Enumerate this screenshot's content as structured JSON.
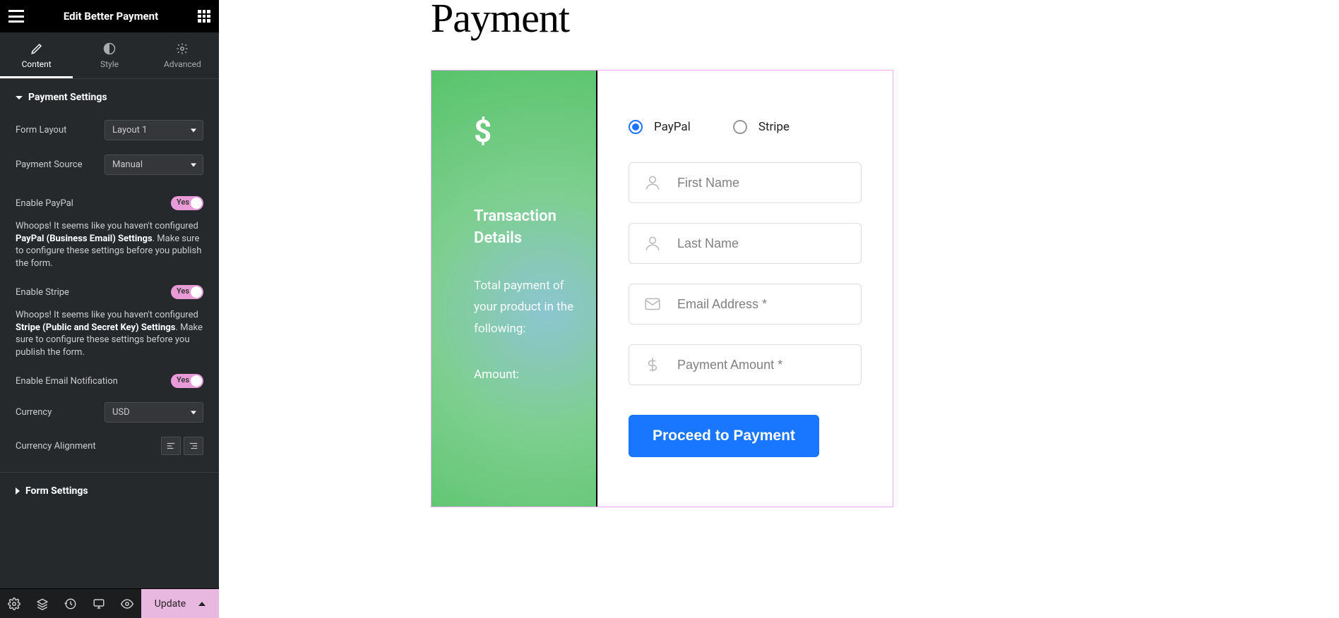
{
  "header": {
    "title": "Edit Better Payment"
  },
  "tabs": {
    "content": "Content",
    "style": "Style",
    "advanced": "Advanced"
  },
  "sections": {
    "payment_settings": "Payment Settings",
    "form_settings": "Form Settings"
  },
  "controls": {
    "form_layout": {
      "label": "Form Layout",
      "value": "Layout 1"
    },
    "payment_source": {
      "label": "Payment Source",
      "value": "Manual"
    },
    "enable_paypal": {
      "label": "Enable PayPal",
      "toggle_text": "Yes"
    },
    "paypal_warning_pre": "Whoops! It seems like you haven't configured ",
    "paypal_warning_bold": "PayPal (Business Email) Settings",
    "paypal_warning_post": ". Make sure to configure these settings before you publish the form.",
    "enable_stripe": {
      "label": "Enable Stripe",
      "toggle_text": "Yes"
    },
    "stripe_warning_pre": "Whoops! It seems like you haven't configured ",
    "stripe_warning_bold": "Stripe (Public and Secret Key) Settings",
    "stripe_warning_post": ". Make sure to configure these settings before you publish the form.",
    "enable_email": {
      "label": "Enable Email Notification",
      "toggle_text": "Yes"
    },
    "currency": {
      "label": "Currency",
      "value": "USD"
    },
    "currency_alignment": {
      "label": "Currency Alignment"
    }
  },
  "footer": {
    "update": "Update"
  },
  "page": {
    "title": "Payment"
  },
  "widget": {
    "left": {
      "heading": "Transaction Details",
      "desc": "Total payment of your product in the following:",
      "amount_label": "Amount:"
    },
    "right": {
      "paypal": "PayPal",
      "stripe": "Stripe",
      "first_name": "First Name",
      "last_name": "Last Name",
      "email": "Email Address *",
      "amount": "Payment Amount *",
      "button": "Proceed to Payment"
    }
  }
}
